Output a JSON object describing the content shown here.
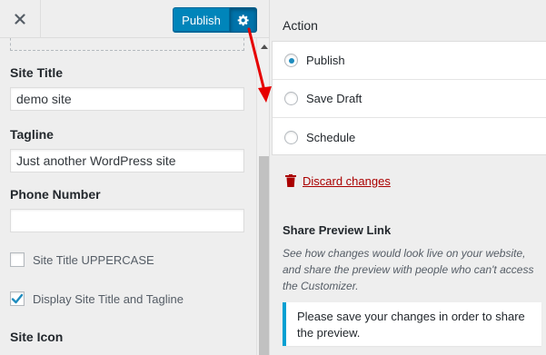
{
  "topbar": {
    "close_icon": "close-icon",
    "publish_label": "Publish",
    "settings_icon": "gear-icon"
  },
  "fields": {
    "site_title": {
      "label": "Site Title",
      "value": "demo site"
    },
    "tagline": {
      "label": "Tagline",
      "value": "Just another WordPress site"
    },
    "phone": {
      "label": "Phone Number",
      "value": ""
    },
    "uppercase": {
      "label": "Site Title UPPERCASE",
      "checked": false
    },
    "display_title": {
      "label": "Display Site Title and Tagline",
      "checked": true
    },
    "site_icon": {
      "label": "Site Icon"
    }
  },
  "publish_settings": {
    "action_heading": "Action",
    "options": [
      {
        "label": "Publish",
        "selected": true
      },
      {
        "label": "Save Draft",
        "selected": false
      },
      {
        "label": "Schedule",
        "selected": false
      }
    ],
    "discard_label": "Discard changes",
    "discard_icon": "trash-icon",
    "share_heading": "Share Preview Link",
    "share_description": "See how changes would look live on your website, and share the preview with people who can't access the Customizer.",
    "notice": "Please save your changes in order to share the preview."
  },
  "colors": {
    "primary_button": "#0085ba",
    "radio_selected": "#1e8cbe",
    "discard": "#aa0000",
    "notice_border": "#00a0d2",
    "annotation_arrow": "#e60000"
  }
}
